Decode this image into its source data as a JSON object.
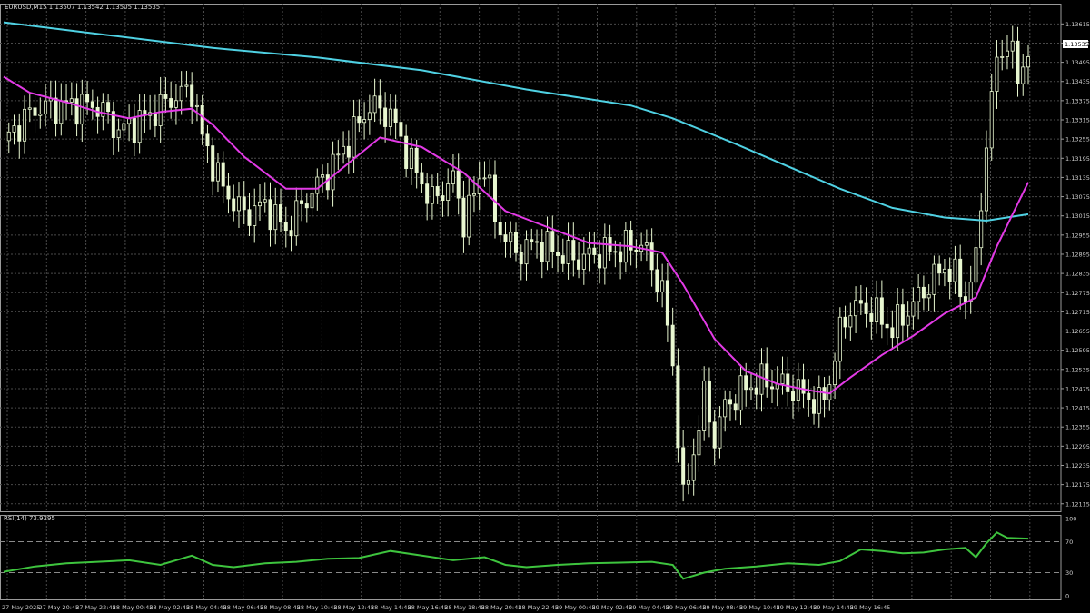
{
  "chart_data": [
    {
      "type": "candlestick",
      "title": "EURUSD,M15  1.13507 1.13542 1.13505 1.13535",
      "last_price_label": "1.13535",
      "ylim": [
        1.1212,
        1.1365
      ],
      "y_ticks": [
        "1.13615",
        "1.13555",
        "1.13495",
        "1.13435",
        "1.13375",
        "1.13315",
        "1.13255",
        "1.13195",
        "1.13135",
        "1.13075",
        "1.13015",
        "1.12955",
        "1.12895",
        "1.12835",
        "1.12775",
        "1.12715",
        "1.12655",
        "1.12595",
        "1.12535",
        "1.12475",
        "1.12415",
        "1.12355",
        "1.12295",
        "1.12235",
        "1.12175",
        "1.12115"
      ],
      "x_ticks": [
        "27 May 2025",
        "27 May 20:45",
        "27 May 22:45",
        "28 May 00:45",
        "28 May 02:45",
        "28 May 04:45",
        "28 May 06:45",
        "28 May 08:45",
        "28 May 10:45",
        "28 May 12:45",
        "28 May 14:45",
        "28 May 16:45",
        "28 May 18:45",
        "28 May 20:45",
        "28 May 22:45",
        "29 May 00:45",
        "29 May 02:45",
        "29 May 04:45",
        "29 May 06:45",
        "29 May 08:45",
        "29 May 10:45",
        "29 May 12:45",
        "29 May 14:45",
        "29 May 16:45"
      ],
      "price_path": [
        [
          0,
          1.1325
        ],
        [
          6,
          1.1335
        ],
        [
          12,
          1.1336
        ],
        [
          18,
          1.1336
        ],
        [
          22,
          1.1328
        ],
        [
          27,
          1.1332
        ],
        [
          32,
          1.1338
        ],
        [
          36,
          1.1341
        ],
        [
          38,
          1.1326
        ],
        [
          42,
          1.131
        ],
        [
          46,
          1.1302
        ],
        [
          50,
          1.1305
        ],
        [
          54,
          1.1297
        ],
        [
          58,
          1.1307
        ],
        [
          62,
          1.1315
        ],
        [
          66,
          1.1325
        ],
        [
          70,
          1.1336
        ],
        [
          74,
          1.1333
        ],
        [
          78,
          1.1318
        ],
        [
          82,
          1.1306
        ],
        [
          86,
          1.1313
        ],
        [
          88,
          1.13
        ],
        [
          90,
          1.1308
        ],
        [
          92,
          1.1318
        ],
        [
          94,
          1.13
        ],
        [
          98,
          1.129
        ],
        [
          102,
          1.1293
        ],
        [
          106,
          1.129
        ],
        [
          110,
          1.1288
        ],
        [
          114,
          1.129
        ],
        [
          118,
          1.1291
        ],
        [
          122,
          1.1293
        ],
        [
          126,
          1.1278
        ],
        [
          128,
          1.1255
        ],
        [
          130,
          1.1212
        ],
        [
          132,
          1.1228
        ],
        [
          134,
          1.1245
        ],
        [
          136,
          1.1232
        ],
        [
          138,
          1.1242
        ],
        [
          142,
          1.1248
        ],
        [
          146,
          1.125
        ],
        [
          150,
          1.1248
        ],
        [
          154,
          1.1245
        ],
        [
          156,
          1.1242
        ],
        [
          158,
          1.125
        ],
        [
          160,
          1.1265
        ],
        [
          162,
          1.1273
        ],
        [
          166,
          1.1272
        ],
        [
          170,
          1.1266
        ],
        [
          174,
          1.1274
        ],
        [
          178,
          1.1282
        ],
        [
          180,
          1.1286
        ],
        [
          182,
          1.1282
        ],
        [
          184,
          1.1276
        ],
        [
          186,
          1.1287
        ],
        [
          188,
          1.1325
        ],
        [
          190,
          1.135
        ],
        [
          192,
          1.1356
        ],
        [
          194,
          1.1345
        ],
        [
          196,
          1.1353
        ]
      ],
      "ma_fast": {
        "color": "#e33ae6",
        "values": [
          [
            0,
            1.1345
          ],
          [
            5,
            1.134
          ],
          [
            12,
            1.1337
          ],
          [
            18,
            1.1334
          ],
          [
            24,
            1.1332
          ],
          [
            30,
            1.1334
          ],
          [
            36,
            1.1335
          ],
          [
            40,
            1.133
          ],
          [
            46,
            1.132
          ],
          [
            54,
            1.131
          ],
          [
            60,
            1.131
          ],
          [
            66,
            1.1318
          ],
          [
            72,
            1.1326
          ],
          [
            80,
            1.1323
          ],
          [
            88,
            1.1315
          ],
          [
            96,
            1.1303
          ],
          [
            104,
            1.1298
          ],
          [
            112,
            1.1293
          ],
          [
            120,
            1.1292
          ],
          [
            126,
            1.129
          ],
          [
            130,
            1.128
          ],
          [
            136,
            1.1263
          ],
          [
            142,
            1.1253
          ],
          [
            148,
            1.1249
          ],
          [
            154,
            1.1247
          ],
          [
            158,
            1.1246
          ],
          [
            162,
            1.1251
          ],
          [
            168,
            1.1258
          ],
          [
            174,
            1.1264
          ],
          [
            180,
            1.1271
          ],
          [
            186,
            1.1276
          ],
          [
            190,
            1.1292
          ],
          [
            196,
            1.1312
          ]
        ]
      },
      "ma_slow": {
        "color": "#4fd1e3",
        "values": [
          [
            0,
            1.1362
          ],
          [
            20,
            1.1358
          ],
          [
            40,
            1.1354
          ],
          [
            60,
            1.1351
          ],
          [
            80,
            1.1347
          ],
          [
            100,
            1.1341
          ],
          [
            120,
            1.1336
          ],
          [
            128,
            1.1332
          ],
          [
            140,
            1.1324
          ],
          [
            160,
            1.131
          ],
          [
            170,
            1.1304
          ],
          [
            180,
            1.1301
          ],
          [
            188,
            1.13
          ],
          [
            196,
            1.1302
          ]
        ]
      }
    },
    {
      "type": "line",
      "title": "RSI(14) 73.9395",
      "ylim": [
        0,
        100
      ],
      "y_ticks": [
        "100",
        "70",
        "30",
        "0"
      ],
      "levels": [
        70,
        30
      ],
      "color": "#3ec43e",
      "values": [
        [
          0,
          31
        ],
        [
          6,
          38
        ],
        [
          12,
          42
        ],
        [
          18,
          44
        ],
        [
          24,
          46
        ],
        [
          30,
          40
        ],
        [
          36,
          52
        ],
        [
          40,
          40
        ],
        [
          44,
          37
        ],
        [
          50,
          42
        ],
        [
          56,
          44
        ],
        [
          62,
          48
        ],
        [
          68,
          49
        ],
        [
          74,
          58
        ],
        [
          80,
          52
        ],
        [
          86,
          46
        ],
        [
          92,
          50
        ],
        [
          96,
          40
        ],
        [
          100,
          37
        ],
        [
          106,
          40
        ],
        [
          112,
          42
        ],
        [
          118,
          43
        ],
        [
          124,
          44
        ],
        [
          128,
          40
        ],
        [
          130,
          22
        ],
        [
          134,
          30
        ],
        [
          138,
          35
        ],
        [
          144,
          38
        ],
        [
          150,
          42
        ],
        [
          156,
          40
        ],
        [
          160,
          45
        ],
        [
          164,
          60
        ],
        [
          168,
          58
        ],
        [
          172,
          55
        ],
        [
          176,
          56
        ],
        [
          180,
          60
        ],
        [
          184,
          62
        ],
        [
          186,
          50
        ],
        [
          188,
          68
        ],
        [
          190,
          82
        ],
        [
          192,
          75
        ],
        [
          196,
          74
        ]
      ]
    }
  ]
}
